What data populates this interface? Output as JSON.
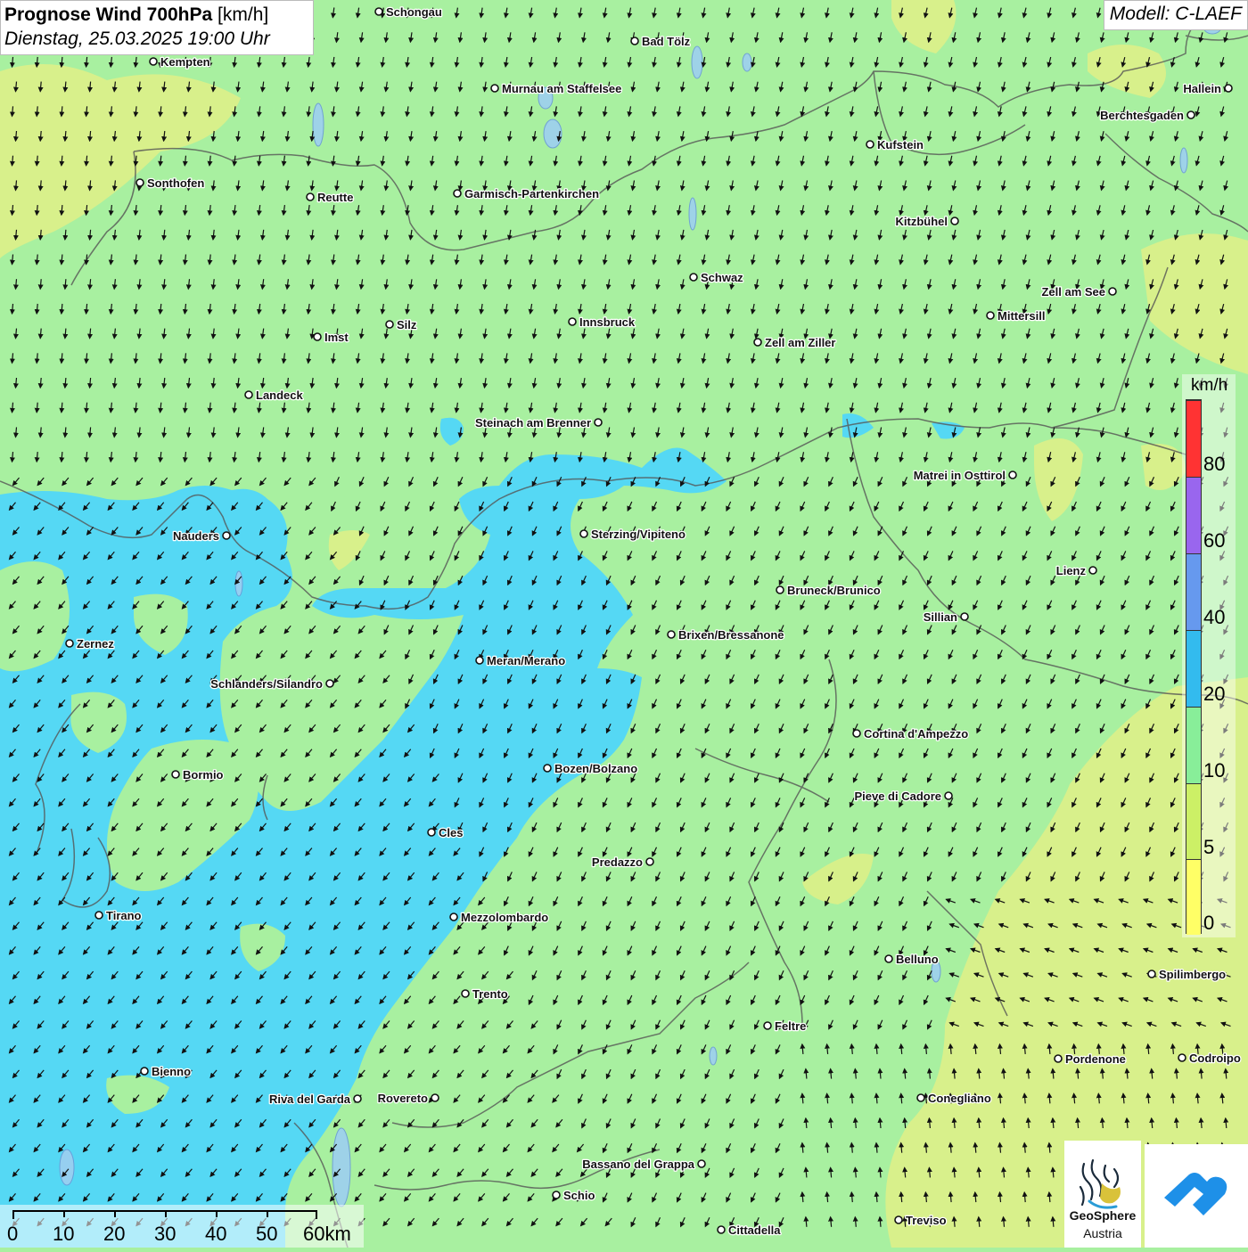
{
  "title": {
    "line1_bold": "Prognose Wind 700hPa",
    "line1_unit": "[km/h]",
    "line2": "Dienstag, 25.03.2025 19:00 Uhr"
  },
  "model_label": "Modell: C-LAEF",
  "legend": {
    "unit": "km/h",
    "labels": [
      "80",
      "60",
      "40",
      "20",
      "10",
      "5",
      "0"
    ],
    "colors": [
      "#ff3333",
      "#9966ee",
      "#6699ee",
      "#33bbee",
      "#88ee99",
      "#ccf066",
      "#ffff66"
    ]
  },
  "scale_bar": {
    "labels": [
      "0",
      "10",
      "20",
      "30",
      "40",
      "50",
      "60km"
    ]
  },
  "logo": {
    "line1": "GeoSphere",
    "line2": "Austria"
  },
  "colors": {
    "green_field": "#a8f0a0",
    "blue_field": "#55d8f4",
    "yellow_field": "#ddf088"
  },
  "cities": [
    {
      "name": "Schongau"
    },
    {
      "name": "Bad Tölz"
    },
    {
      "name": "Kempten"
    },
    {
      "name": "Hallein"
    },
    {
      "name": "Murnau am Staffelsee"
    },
    {
      "name": "Berchtesgaden"
    },
    {
      "name": "Kufstein"
    },
    {
      "name": "Sonthofen"
    },
    {
      "name": "Reutte"
    },
    {
      "name": "Garmisch-Partenkirchen"
    },
    {
      "name": "Kitzbühel"
    },
    {
      "name": "Schwaz"
    },
    {
      "name": "Zell am See"
    },
    {
      "name": "Mittersill"
    },
    {
      "name": "Silz"
    },
    {
      "name": "Innsbruck"
    },
    {
      "name": "Imst"
    },
    {
      "name": "Zell am Ziller"
    },
    {
      "name": "Landeck"
    },
    {
      "name": "Steinach am Brenner"
    },
    {
      "name": "Matrei in Osttirol"
    },
    {
      "name": "Nauders"
    },
    {
      "name": "Sterzing/Vipiteno"
    },
    {
      "name": "Lienz"
    },
    {
      "name": "Bruneck/Brunico"
    },
    {
      "name": "Sillian"
    },
    {
      "name": "Brixen/Bressanone"
    },
    {
      "name": "Zernez"
    },
    {
      "name": "Meran/Merano"
    },
    {
      "name": "Schlanders/Silandro"
    },
    {
      "name": "Cortina d'Ampezzo"
    },
    {
      "name": "Bozen/Bolzano"
    },
    {
      "name": "Bormio"
    },
    {
      "name": "Pieve di Cadore"
    },
    {
      "name": "Cles"
    },
    {
      "name": "Predazzo"
    },
    {
      "name": "Tirano"
    },
    {
      "name": "Mezzolombardo"
    },
    {
      "name": "Belluno"
    },
    {
      "name": "Spilimbergo"
    },
    {
      "name": "Trento"
    },
    {
      "name": "Feltre"
    },
    {
      "name": "Pordenone"
    },
    {
      "name": "Codroipo"
    },
    {
      "name": "Bienno"
    },
    {
      "name": "Riva del Garda"
    },
    {
      "name": "Rovereto"
    },
    {
      "name": "Conegliano"
    },
    {
      "name": "Bassano del Grappa"
    },
    {
      "name": "Schio"
    },
    {
      "name": "Treviso"
    },
    {
      "name": "Cittadella"
    }
  ]
}
